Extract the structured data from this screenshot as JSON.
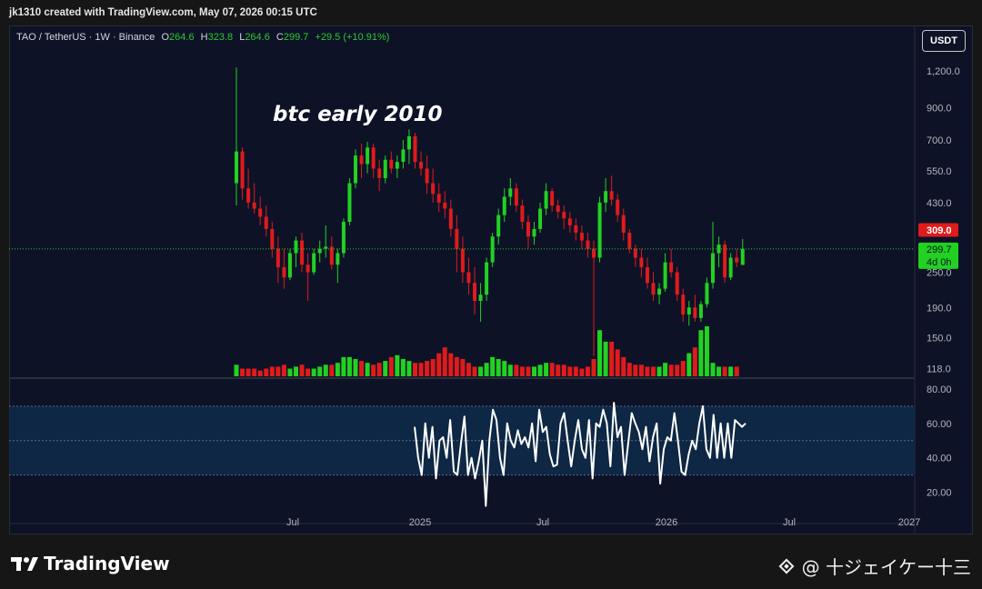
{
  "header": {
    "caption": "jk1310 created with TradingView.com, May 07, 2026 00:15 UTC"
  },
  "legend": {
    "symbol": "TAO / TetherUS · 1W · Binance",
    "o_label": "O",
    "o_value": "264.6",
    "h_label": "H",
    "h_value": "323.8",
    "l_label": "L",
    "l_value": "264.6",
    "c_label": "C",
    "c_value": "299.7",
    "change": "+29.5 (+10.91%)"
  },
  "currency_button": "USDT",
  "annotation": "btc early 2010",
  "price_labels": {
    "high_marker": "309.0",
    "last_price": "299.7",
    "countdown": "4d 0h"
  },
  "footer": {
    "brand": "TradingView",
    "credit": "@ 十ジェイケー十三"
  },
  "colors": {
    "up": "#22d122",
    "down": "#e01b1b",
    "background": "#0d1227",
    "rsi_line": "#ffffff",
    "rsi_band": "#0e2b4a"
  },
  "chart_data": [
    {
      "type": "candlestick",
      "title": "TAO / TetherUS · 1W · Binance",
      "y_scale": "log",
      "y_ticks": [
        118,
        150,
        190,
        250,
        309,
        430,
        550,
        700,
        900,
        1200
      ],
      "y_tick_labels": [
        "118.0",
        "150.0",
        "190.0",
        "250.0",
        "309.0",
        "430.0",
        "550.0",
        "700.0",
        "900.0",
        "1,200.0"
      ],
      "x_tick_labels": [
        "Jul",
        "2025",
        "Jul",
        "2026",
        "Jul",
        "2027"
      ],
      "current_price_line": 299.7,
      "candles": [
        {
          "o": 500,
          "h": 1230,
          "l": 420,
          "c": 640
        },
        {
          "o": 640,
          "h": 660,
          "l": 440,
          "c": 480
        },
        {
          "o": 480,
          "h": 560,
          "l": 410,
          "c": 430
        },
        {
          "o": 430,
          "h": 500,
          "l": 395,
          "c": 410
        },
        {
          "o": 410,
          "h": 450,
          "l": 360,
          "c": 385
        },
        {
          "o": 385,
          "h": 420,
          "l": 330,
          "c": 350
        },
        {
          "o": 350,
          "h": 370,
          "l": 280,
          "c": 300
        },
        {
          "o": 300,
          "h": 330,
          "l": 230,
          "c": 260
        },
        {
          "o": 260,
          "h": 300,
          "l": 220,
          "c": 240
        },
        {
          "o": 240,
          "h": 300,
          "l": 235,
          "c": 290
        },
        {
          "o": 290,
          "h": 330,
          "l": 260,
          "c": 320
        },
        {
          "o": 320,
          "h": 340,
          "l": 250,
          "c": 265
        },
        {
          "o": 265,
          "h": 290,
          "l": 200,
          "c": 250
        },
        {
          "o": 250,
          "h": 300,
          "l": 245,
          "c": 290
        },
        {
          "o": 290,
          "h": 320,
          "l": 270,
          "c": 300
        },
        {
          "o": 300,
          "h": 360,
          "l": 280,
          "c": 305
        },
        {
          "o": 305,
          "h": 330,
          "l": 255,
          "c": 265
        },
        {
          "o": 265,
          "h": 300,
          "l": 230,
          "c": 290
        },
        {
          "o": 290,
          "h": 380,
          "l": 280,
          "c": 370
        },
        {
          "o": 370,
          "h": 520,
          "l": 360,
          "c": 500
        },
        {
          "o": 500,
          "h": 650,
          "l": 480,
          "c": 620
        },
        {
          "o": 620,
          "h": 680,
          "l": 520,
          "c": 580
        },
        {
          "o": 580,
          "h": 690,
          "l": 540,
          "c": 660
        },
        {
          "o": 660,
          "h": 680,
          "l": 520,
          "c": 560
        },
        {
          "o": 560,
          "h": 600,
          "l": 470,
          "c": 520
        },
        {
          "o": 520,
          "h": 620,
          "l": 500,
          "c": 600
        },
        {
          "o": 600,
          "h": 640,
          "l": 540,
          "c": 560
        },
        {
          "o": 560,
          "h": 620,
          "l": 520,
          "c": 590
        },
        {
          "o": 590,
          "h": 700,
          "l": 560,
          "c": 650
        },
        {
          "o": 650,
          "h": 760,
          "l": 580,
          "c": 720
        },
        {
          "o": 720,
          "h": 740,
          "l": 560,
          "c": 590
        },
        {
          "o": 590,
          "h": 640,
          "l": 530,
          "c": 560
        },
        {
          "o": 560,
          "h": 620,
          "l": 460,
          "c": 500
        },
        {
          "o": 500,
          "h": 560,
          "l": 430,
          "c": 460
        },
        {
          "o": 460,
          "h": 500,
          "l": 400,
          "c": 430
        },
        {
          "o": 430,
          "h": 470,
          "l": 380,
          "c": 410
        },
        {
          "o": 410,
          "h": 440,
          "l": 330,
          "c": 350
        },
        {
          "o": 350,
          "h": 390,
          "l": 250,
          "c": 300
        },
        {
          "o": 300,
          "h": 330,
          "l": 230,
          "c": 250
        },
        {
          "o": 250,
          "h": 280,
          "l": 210,
          "c": 230
        },
        {
          "o": 230,
          "h": 260,
          "l": 180,
          "c": 200
        },
        {
          "o": 200,
          "h": 230,
          "l": 170,
          "c": 210
        },
        {
          "o": 210,
          "h": 280,
          "l": 200,
          "c": 270
        },
        {
          "o": 270,
          "h": 340,
          "l": 260,
          "c": 330
        },
        {
          "o": 330,
          "h": 410,
          "l": 310,
          "c": 390
        },
        {
          "o": 390,
          "h": 480,
          "l": 370,
          "c": 450
        },
        {
          "o": 450,
          "h": 520,
          "l": 420,
          "c": 480
        },
        {
          "o": 480,
          "h": 500,
          "l": 400,
          "c": 420
        },
        {
          "o": 420,
          "h": 440,
          "l": 350,
          "c": 370
        },
        {
          "o": 370,
          "h": 390,
          "l": 300,
          "c": 330
        },
        {
          "o": 330,
          "h": 370,
          "l": 310,
          "c": 350
        },
        {
          "o": 350,
          "h": 430,
          "l": 340,
          "c": 410
        },
        {
          "o": 410,
          "h": 500,
          "l": 390,
          "c": 470
        },
        {
          "o": 470,
          "h": 480,
          "l": 400,
          "c": 420
        },
        {
          "o": 420,
          "h": 440,
          "l": 380,
          "c": 400
        },
        {
          "o": 400,
          "h": 420,
          "l": 350,
          "c": 380
        },
        {
          "o": 380,
          "h": 400,
          "l": 340,
          "c": 360
        },
        {
          "o": 360,
          "h": 380,
          "l": 320,
          "c": 340
        },
        {
          "o": 340,
          "h": 360,
          "l": 300,
          "c": 320
        },
        {
          "o": 320,
          "h": 340,
          "l": 280,
          "c": 300
        },
        {
          "o": 300,
          "h": 320,
          "l": 130,
          "c": 280
        },
        {
          "o": 280,
          "h": 450,
          "l": 270,
          "c": 430
        },
        {
          "o": 430,
          "h": 520,
          "l": 400,
          "c": 470
        },
        {
          "o": 470,
          "h": 530,
          "l": 420,
          "c": 440
        },
        {
          "o": 440,
          "h": 460,
          "l": 370,
          "c": 390
        },
        {
          "o": 390,
          "h": 410,
          "l": 320,
          "c": 340
        },
        {
          "o": 340,
          "h": 350,
          "l": 290,
          "c": 300
        },
        {
          "o": 300,
          "h": 310,
          "l": 260,
          "c": 280
        },
        {
          "o": 280,
          "h": 300,
          "l": 240,
          "c": 260
        },
        {
          "o": 260,
          "h": 280,
          "l": 220,
          "c": 230
        },
        {
          "o": 230,
          "h": 250,
          "l": 200,
          "c": 210
        },
        {
          "o": 210,
          "h": 230,
          "l": 195,
          "c": 220
        },
        {
          "o": 220,
          "h": 290,
          "l": 215,
          "c": 270
        },
        {
          "o": 270,
          "h": 300,
          "l": 240,
          "c": 250
        },
        {
          "o": 250,
          "h": 260,
          "l": 200,
          "c": 210
        },
        {
          "o": 210,
          "h": 220,
          "l": 170,
          "c": 180
        },
        {
          "o": 180,
          "h": 200,
          "l": 165,
          "c": 190
        },
        {
          "o": 190,
          "h": 210,
          "l": 170,
          "c": 175
        },
        {
          "o": 175,
          "h": 200,
          "l": 170,
          "c": 195
        },
        {
          "o": 195,
          "h": 240,
          "l": 190,
          "c": 230
        },
        {
          "o": 230,
          "h": 370,
          "l": 220,
          "c": 290
        },
        {
          "o": 290,
          "h": 330,
          "l": 260,
          "c": 310
        },
        {
          "o": 310,
          "h": 320,
          "l": 230,
          "c": 240
        },
        {
          "o": 240,
          "h": 290,
          "l": 235,
          "c": 280
        },
        {
          "o": 280,
          "h": 300,
          "l": 260,
          "c": 270
        },
        {
          "o": 264.6,
          "h": 323.8,
          "l": 264.6,
          "c": 299.7
        }
      ],
      "volumes": [
        3,
        2,
        2,
        2,
        1.5,
        2,
        2.5,
        2.5,
        3,
        2,
        2.5,
        3,
        2,
        2,
        2.5,
        3,
        3,
        3.5,
        5,
        5,
        4.5,
        4,
        3.5,
        3,
        3.5,
        4,
        5,
        5.5,
        4.5,
        4,
        3.5,
        3.5,
        4,
        4.5,
        6,
        7.5,
        6,
        5,
        4.5,
        3.5,
        2.5,
        2.5,
        3.5,
        5,
        4.5,
        4,
        3,
        3,
        2.5,
        2.5,
        2.5,
        3,
        3.5,
        3.5,
        3,
        3,
        2.5,
        2.5,
        2,
        2.5,
        4.5,
        12,
        9,
        9,
        7,
        5,
        3.5,
        3,
        3,
        2.5,
        2.5,
        2.5,
        3.5,
        3,
        3,
        4,
        6,
        7.5,
        12,
        13,
        3.5,
        2.5,
        2.5,
        2.5,
        2.5
      ]
    },
    {
      "type": "line",
      "title": "",
      "y_ticks": [
        20,
        40,
        60,
        80
      ],
      "y_tick_labels": [
        "20.00",
        "40.00",
        "60.00",
        "80.00"
      ],
      "bands": [
        30,
        50,
        70
      ],
      "series": [
        {
          "values": [
            58,
            40,
            30,
            60,
            40,
            58,
            28,
            50,
            52,
            40,
            62,
            32,
            30,
            48,
            64,
            30,
            40,
            28,
            38,
            50,
            12,
            50,
            68,
            62,
            40,
            30,
            60,
            50,
            46,
            56,
            48,
            52,
            46,
            60,
            38,
            68,
            55,
            58,
            42,
            35,
            36,
            60,
            66,
            50,
            35,
            50,
            62,
            45,
            40,
            62,
            28,
            60,
            58,
            68,
            60,
            35,
            72,
            52,
            58,
            30,
            48,
            66,
            60,
            55,
            45,
            58,
            38,
            52,
            60,
            25,
            45,
            52,
            50,
            66,
            50,
            32,
            30,
            42,
            50,
            45,
            60,
            70,
            45,
            40,
            65,
            40,
            60,
            40,
            60,
            40,
            62,
            60,
            58,
            60
          ]
        }
      ]
    }
  ]
}
